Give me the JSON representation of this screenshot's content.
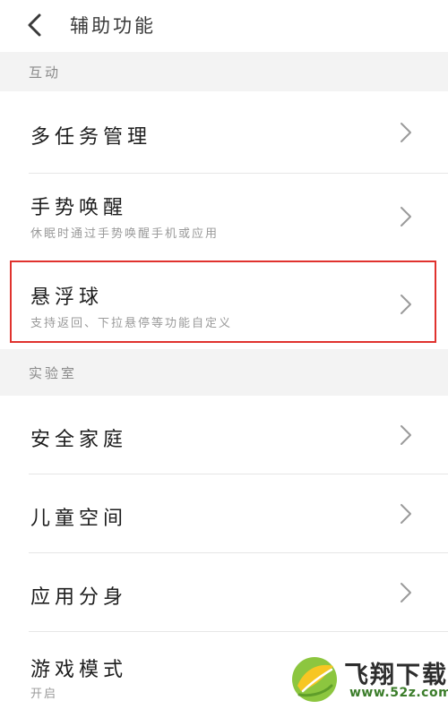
{
  "header": {
    "title": "辅助功能",
    "back_icon": "chevron-left-icon"
  },
  "sections": {
    "interaction": {
      "label": "互动"
    },
    "lab": {
      "label": "实验室"
    }
  },
  "rows": {
    "multitask": {
      "title": "多任务管理"
    },
    "gesture_wake": {
      "title": "手势唤醒",
      "subtitle": "休眠时通过手势唤醒手机或应用"
    },
    "floating_ball": {
      "title": "悬浮球",
      "subtitle": "支持返回、下拉悬停等功能自定义"
    },
    "safe_family": {
      "title": "安全家庭"
    },
    "kids_space": {
      "title": "儿童空间"
    },
    "app_clone": {
      "title": "应用分身"
    },
    "game_mode": {
      "title": "游戏模式",
      "status": "开启"
    }
  },
  "colors": {
    "highlight": "#e0322e",
    "section_bg": "#f3f3f3",
    "divider": "#e6e6e6"
  },
  "watermark": {
    "title": "飞翔下载",
    "url": "www.52z.com"
  }
}
